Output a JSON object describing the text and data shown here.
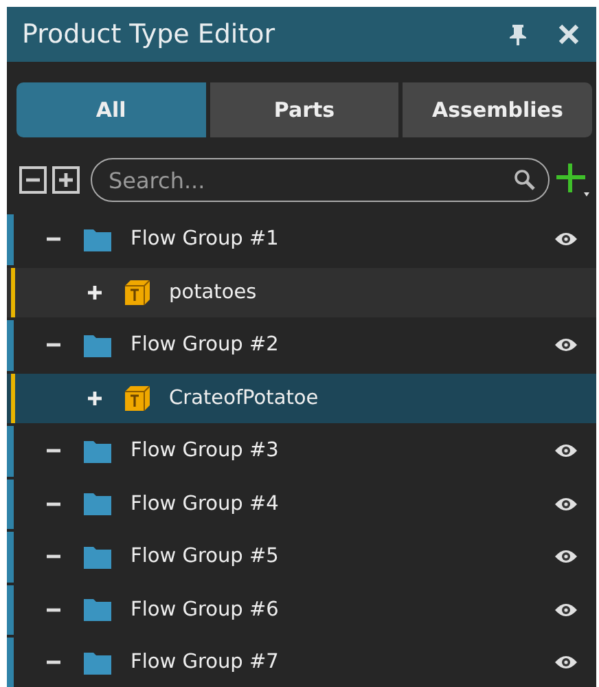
{
  "window": {
    "title": "Product Type Editor"
  },
  "tabs": [
    {
      "label": "All",
      "selected": true
    },
    {
      "label": "Parts",
      "selected": false
    },
    {
      "label": "Assemblies",
      "selected": false
    }
  ],
  "search": {
    "placeholder": "Search..."
  },
  "tree": [
    {
      "label": "Flow Group #1",
      "expanded": true,
      "selected": false,
      "visible": true,
      "children": [
        {
          "label": "potatoes",
          "expanded": false,
          "selected": false
        }
      ]
    },
    {
      "label": "Flow Group #2",
      "expanded": true,
      "selected": false,
      "visible": true,
      "children": [
        {
          "label": "CrateofPotatoe",
          "expanded": false,
          "selected": true
        }
      ]
    },
    {
      "label": "Flow Group #3",
      "expanded": true,
      "selected": false,
      "visible": true
    },
    {
      "label": "Flow Group #4",
      "expanded": true,
      "selected": false,
      "visible": true
    },
    {
      "label": "Flow Group #5",
      "expanded": true,
      "selected": false,
      "visible": true
    },
    {
      "label": "Flow Group #6",
      "expanded": true,
      "selected": false,
      "visible": true
    },
    {
      "label": "Flow Group #7",
      "expanded": true,
      "selected": false,
      "visible": true
    }
  ]
}
